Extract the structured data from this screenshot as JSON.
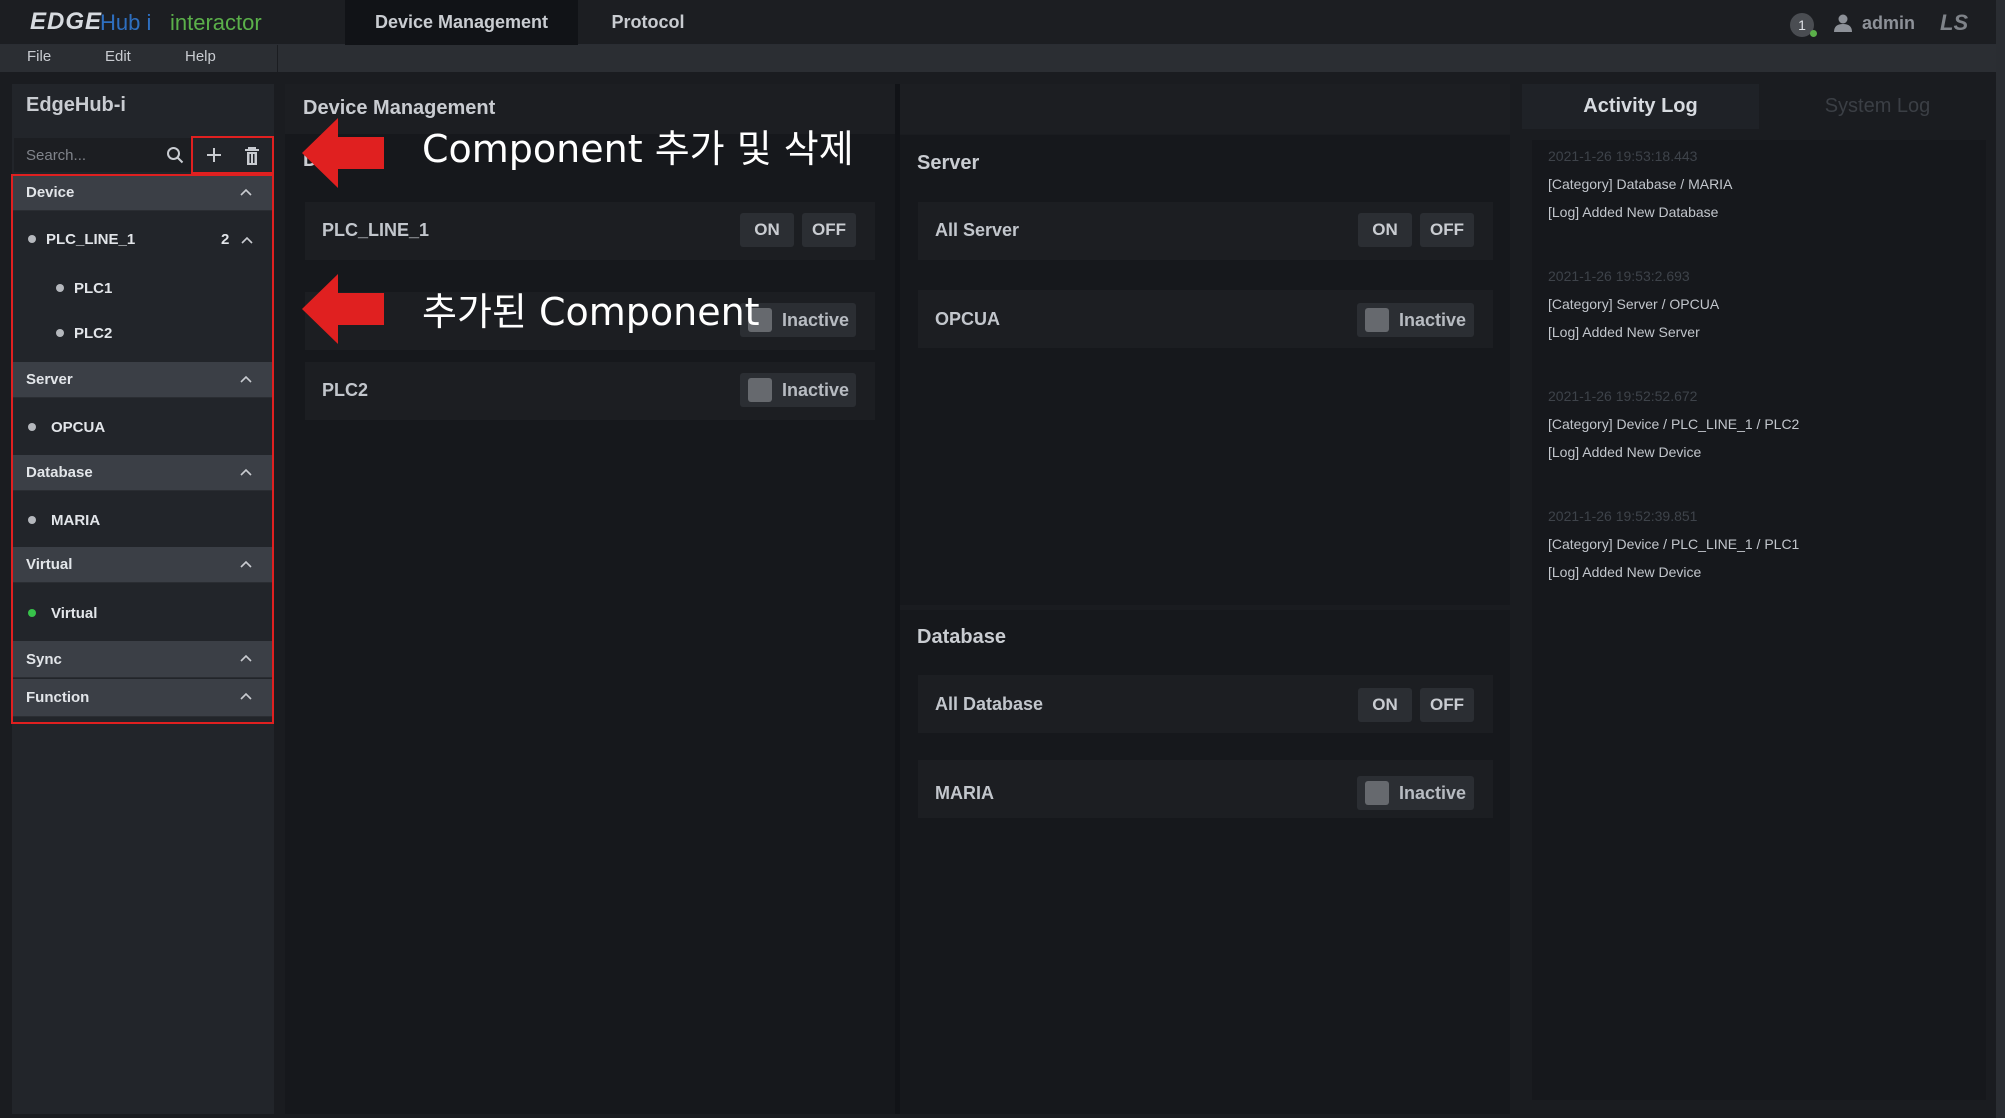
{
  "brand": {
    "edge": "EDGE",
    "hub": "Hub i",
    "interactor": "interactor"
  },
  "top_tabs": [
    {
      "label": "Device Management",
      "active": true
    },
    {
      "label": "Protocol",
      "active": false
    }
  ],
  "header": {
    "notification_count": "1",
    "user": "admin",
    "company_logo": "LS"
  },
  "menu": [
    "File",
    "Edit",
    "Help"
  ],
  "sidebar": {
    "title": "EdgeHub-i",
    "search_placeholder": "Search...",
    "categories": [
      {
        "label": "Device",
        "items": [
          {
            "label": "PLC_LINE_1",
            "count": "2",
            "children": [
              "PLC1",
              "PLC2"
            ]
          }
        ]
      },
      {
        "label": "Server",
        "items": [
          {
            "label": "OPCUA"
          }
        ]
      },
      {
        "label": "Database",
        "items": [
          {
            "label": "MARIA"
          }
        ]
      },
      {
        "label": "Virtual",
        "items": [
          {
            "label": "Virtual",
            "status_color": "#37c24a"
          }
        ]
      },
      {
        "label": "Sync",
        "items": []
      },
      {
        "label": "Function",
        "items": []
      }
    ]
  },
  "main": {
    "title": "Device Management",
    "device_partial_label": "D",
    "device_rows": [
      {
        "label": "PLC_LINE_1",
        "on": "ON",
        "off": "OFF"
      },
      {
        "label": "",
        "status": "Inactive"
      },
      {
        "label": "PLC2",
        "status": "Inactive"
      }
    ],
    "server": {
      "title": "Server",
      "rows": [
        {
          "label": "All Server",
          "on": "ON",
          "off": "OFF"
        },
        {
          "label": "OPCUA",
          "status": "Inactive"
        }
      ]
    },
    "database": {
      "title": "Database",
      "rows": [
        {
          "label": "All Database",
          "on": "ON",
          "off": "OFF"
        },
        {
          "label": "MARIA",
          "status": "Inactive"
        }
      ]
    }
  },
  "logs": {
    "tabs": [
      "Activity Log",
      "System Log"
    ],
    "entries": [
      {
        "time": "2021-1-26 19:53:18.443",
        "category": "[Category] Database / MARIA",
        "log": "[Log] Added New Database"
      },
      {
        "time": "2021-1-26 19:53:2.693",
        "category": "[Category] Server / OPCUA",
        "log": "[Log] Added New Server"
      },
      {
        "time": "2021-1-26 19:52:52.672",
        "category": "[Category] Device / PLC_LINE_1 / PLC2",
        "log": "[Log] Added New Device"
      },
      {
        "time": "2021-1-26 19:52:39.851",
        "category": "[Category] Device / PLC_LINE_1 / PLC1",
        "log": "[Log] Added New Device"
      }
    ]
  },
  "annotations": {
    "add_delete": "Component 추가 및 삭제",
    "added": "추가된 Component"
  },
  "colors": {
    "annotation_red": "#e02020",
    "active_green": "#37c24a"
  }
}
